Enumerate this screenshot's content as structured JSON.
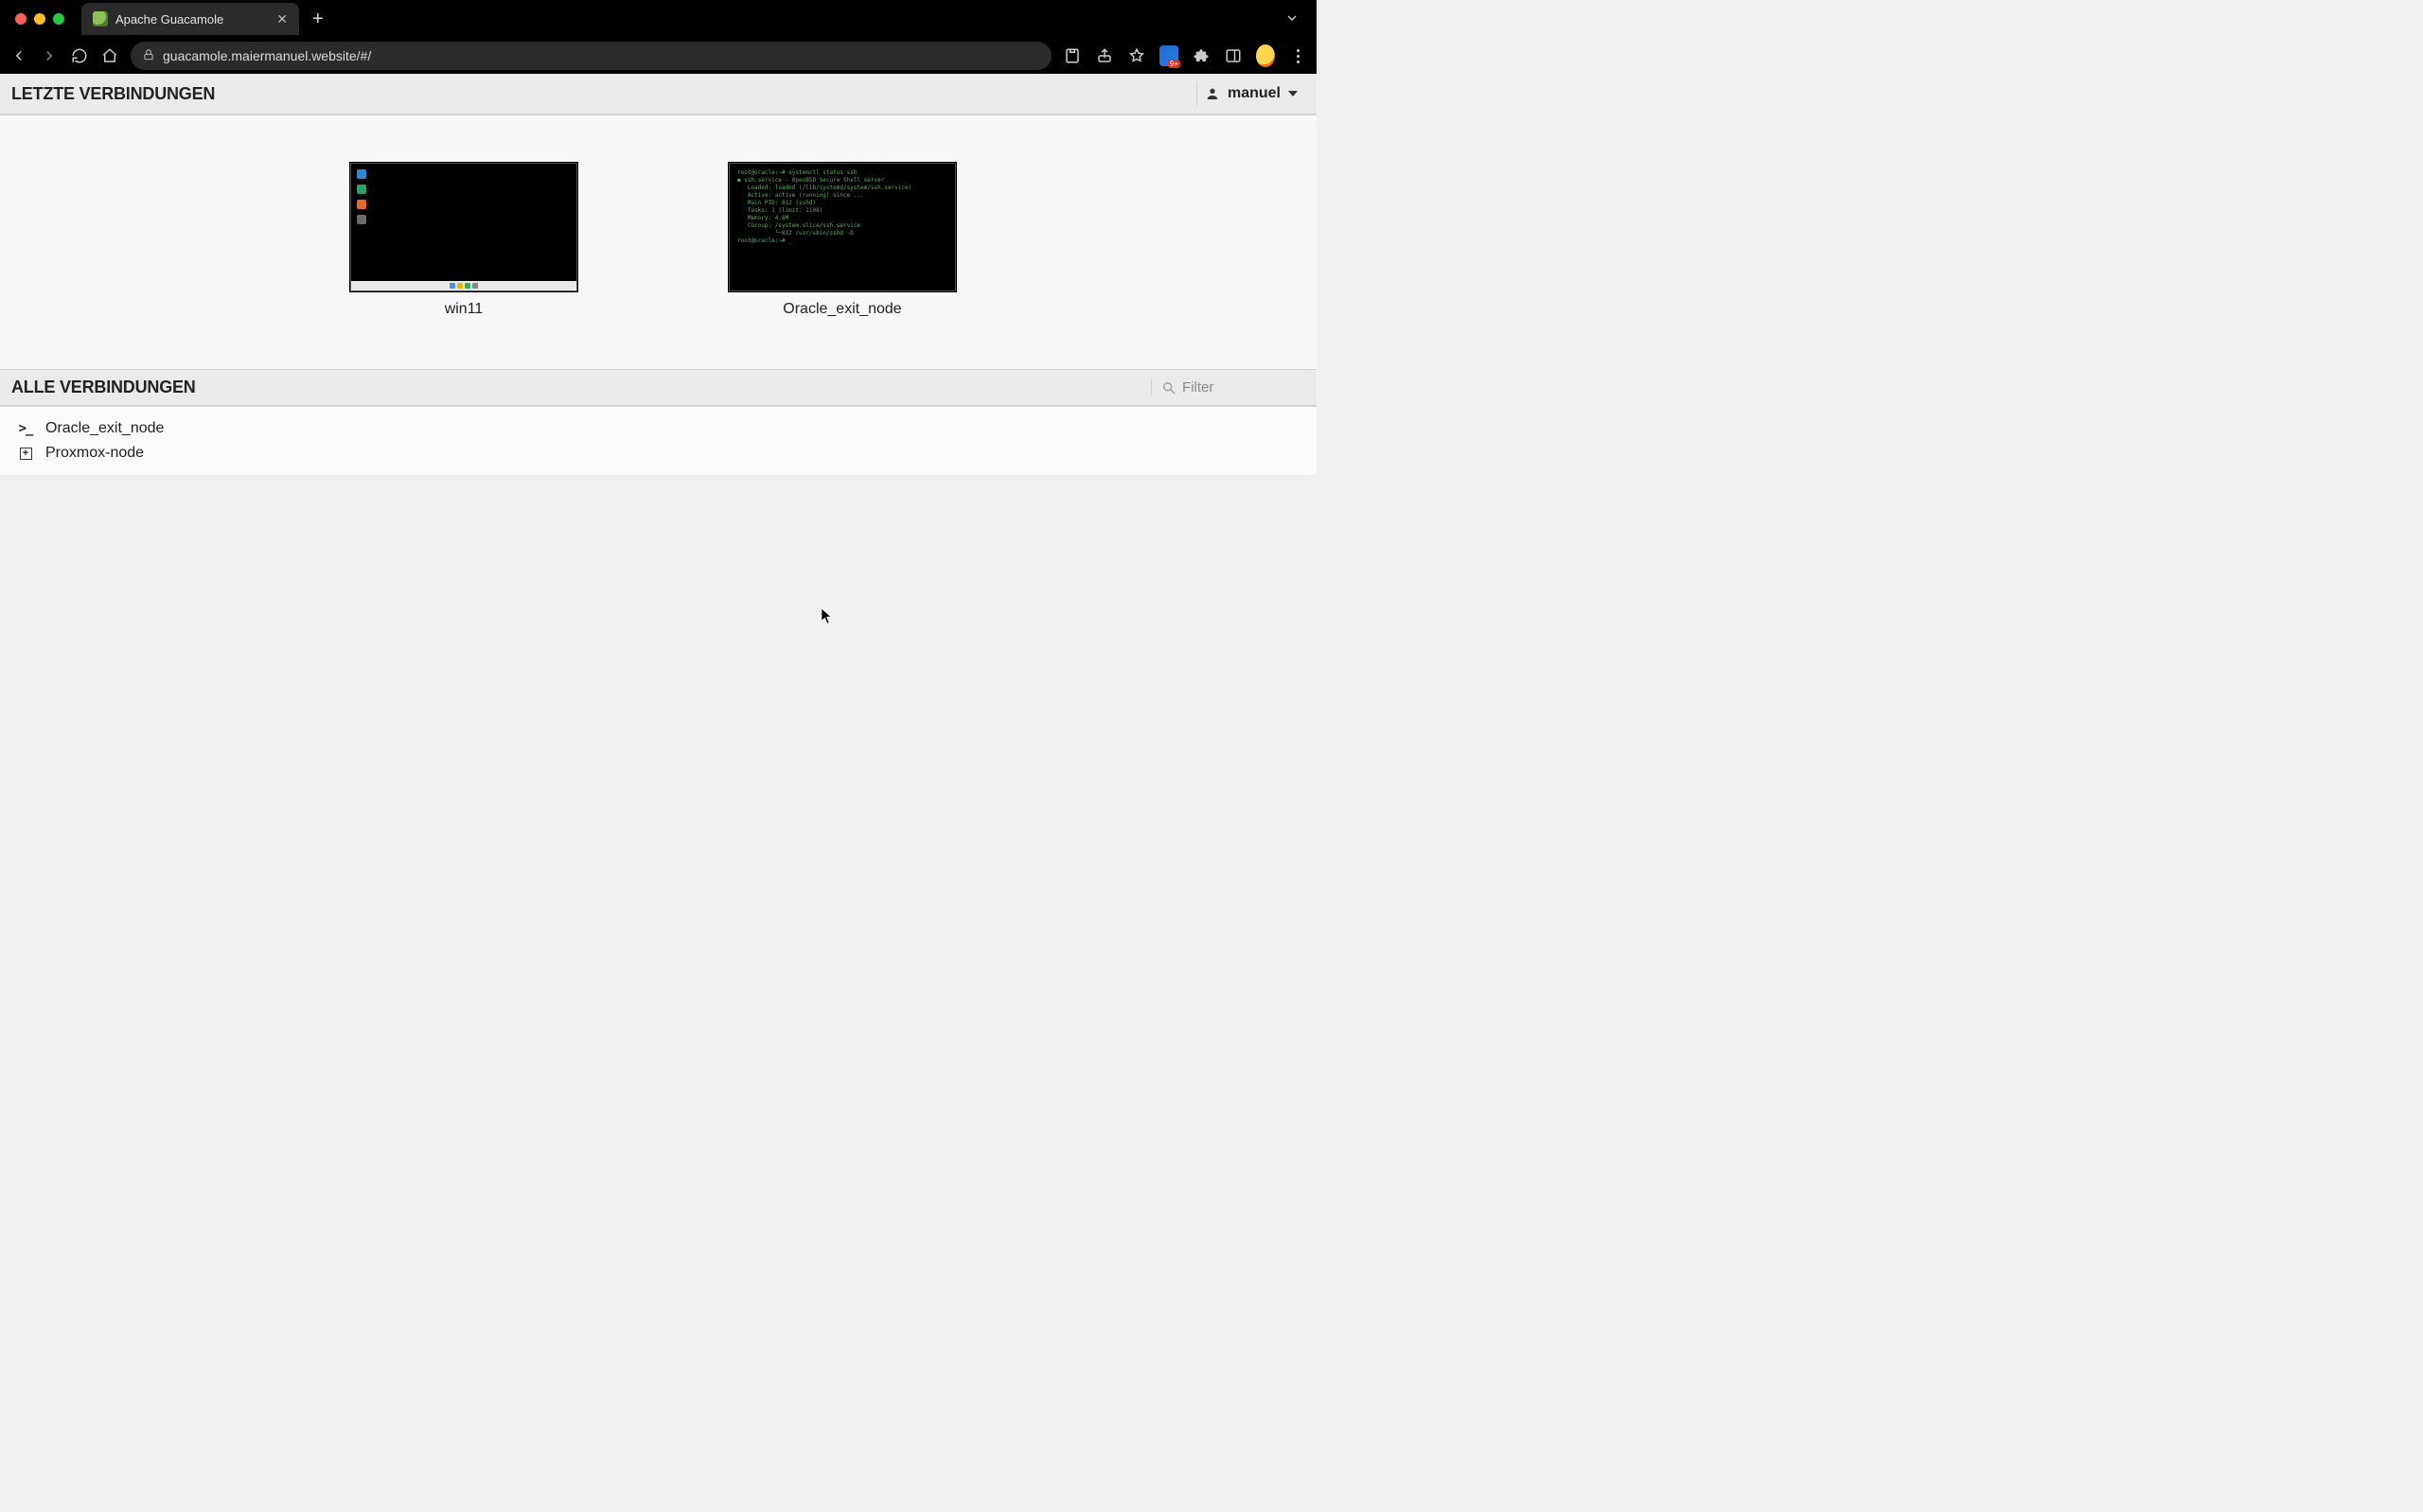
{
  "browser": {
    "tab_title": "Apache Guacamole",
    "url": "guacamole.maiermanuel.website/#/"
  },
  "header": {
    "recent_title": "LETZTE VERBINDUNGEN",
    "user": "manuel"
  },
  "recent": [
    {
      "name": "win11",
      "kind": "windows"
    },
    {
      "name": "Oracle_exit_node",
      "kind": "terminal"
    }
  ],
  "all": {
    "title": "ALLE VERBINDUNGEN",
    "filter_placeholder": "Filter",
    "items": [
      {
        "name": "Oracle_exit_node",
        "type": "connection"
      },
      {
        "name": "Proxmox-node",
        "type": "group"
      }
    ]
  }
}
